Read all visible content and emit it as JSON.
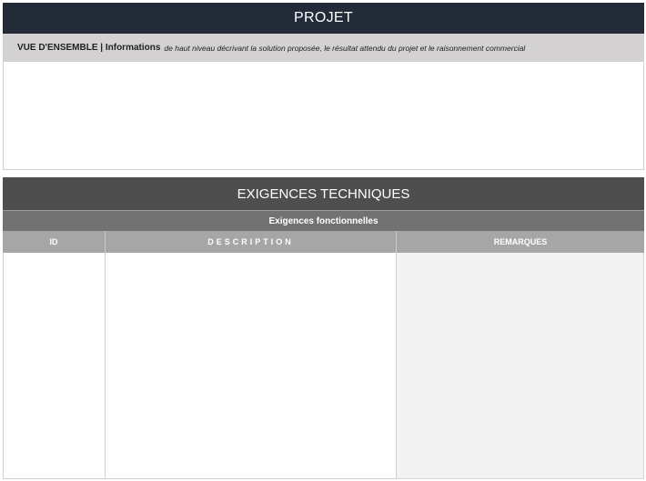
{
  "projet": {
    "title": "PROJET",
    "overview_lead": "VUE D'ENSEMBLE | Informations",
    "overview_desc": "de haut niveau décrivant la solution proposée, le résultat attendu du projet et le raisonnement commercial"
  },
  "technical": {
    "title": "EXIGENCES TECHNIQUES",
    "subtitle": "Exigences fonctionnelles",
    "columns": [
      "ID",
      "DESCRIPTION",
      "REMARQUES"
    ]
  },
  "colors": {
    "projet_header": "#222b37",
    "overview_bar": "#d3d1d2",
    "tech_header": "#4e4e4e",
    "functional_bar": "#727272",
    "column_header": "#a6a6a6",
    "remarks_fill": "#f2f2f2"
  }
}
